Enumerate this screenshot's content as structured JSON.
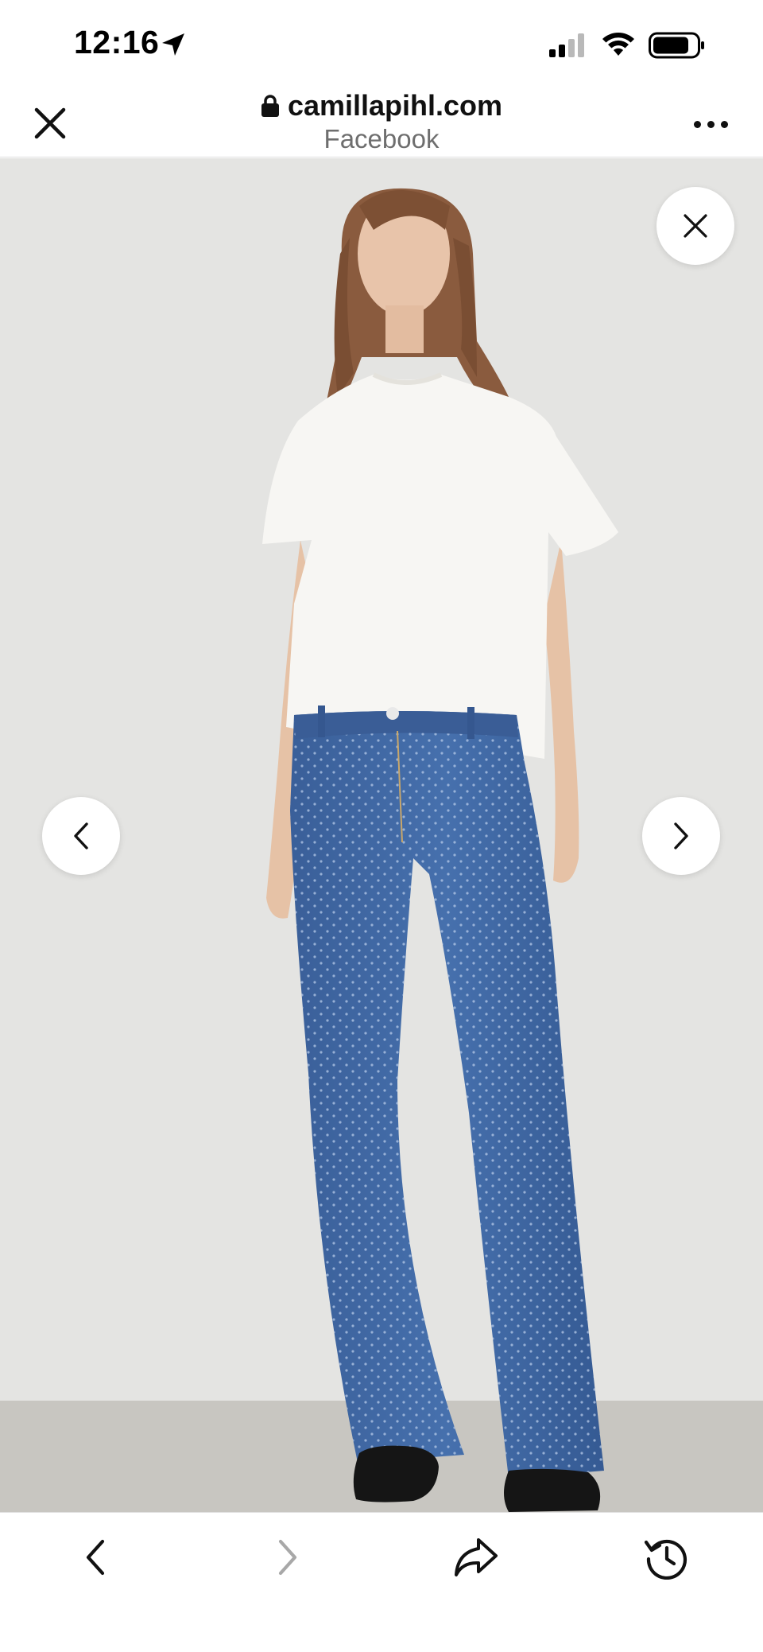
{
  "status_bar": {
    "time": "12:16",
    "icons": [
      "location-arrow-icon",
      "signal-icon",
      "wifi-icon",
      "battery-icon"
    ]
  },
  "browser_header": {
    "close_icon": "close-icon",
    "lock_icon": "lock-icon",
    "url": "camillapihl.com",
    "source": "Facebook",
    "more_icon": "more-dots-icon"
  },
  "gallery": {
    "close_icon": "close-icon",
    "prev_icon": "chevron-left-icon",
    "next_icon": "chevron-right-icon",
    "image": "product-photo"
  },
  "toolbar": {
    "items": [
      "chevron-left-icon",
      "chevron-right-icon",
      "share-icon",
      "history-icon"
    ]
  },
  "colors": {
    "background": "#e4e4e2",
    "floor": "#c8c6c1",
    "denim": "#3f67a3",
    "tshirt": "#f7f6f3",
    "disabled_icon": "#a8a8a8"
  }
}
